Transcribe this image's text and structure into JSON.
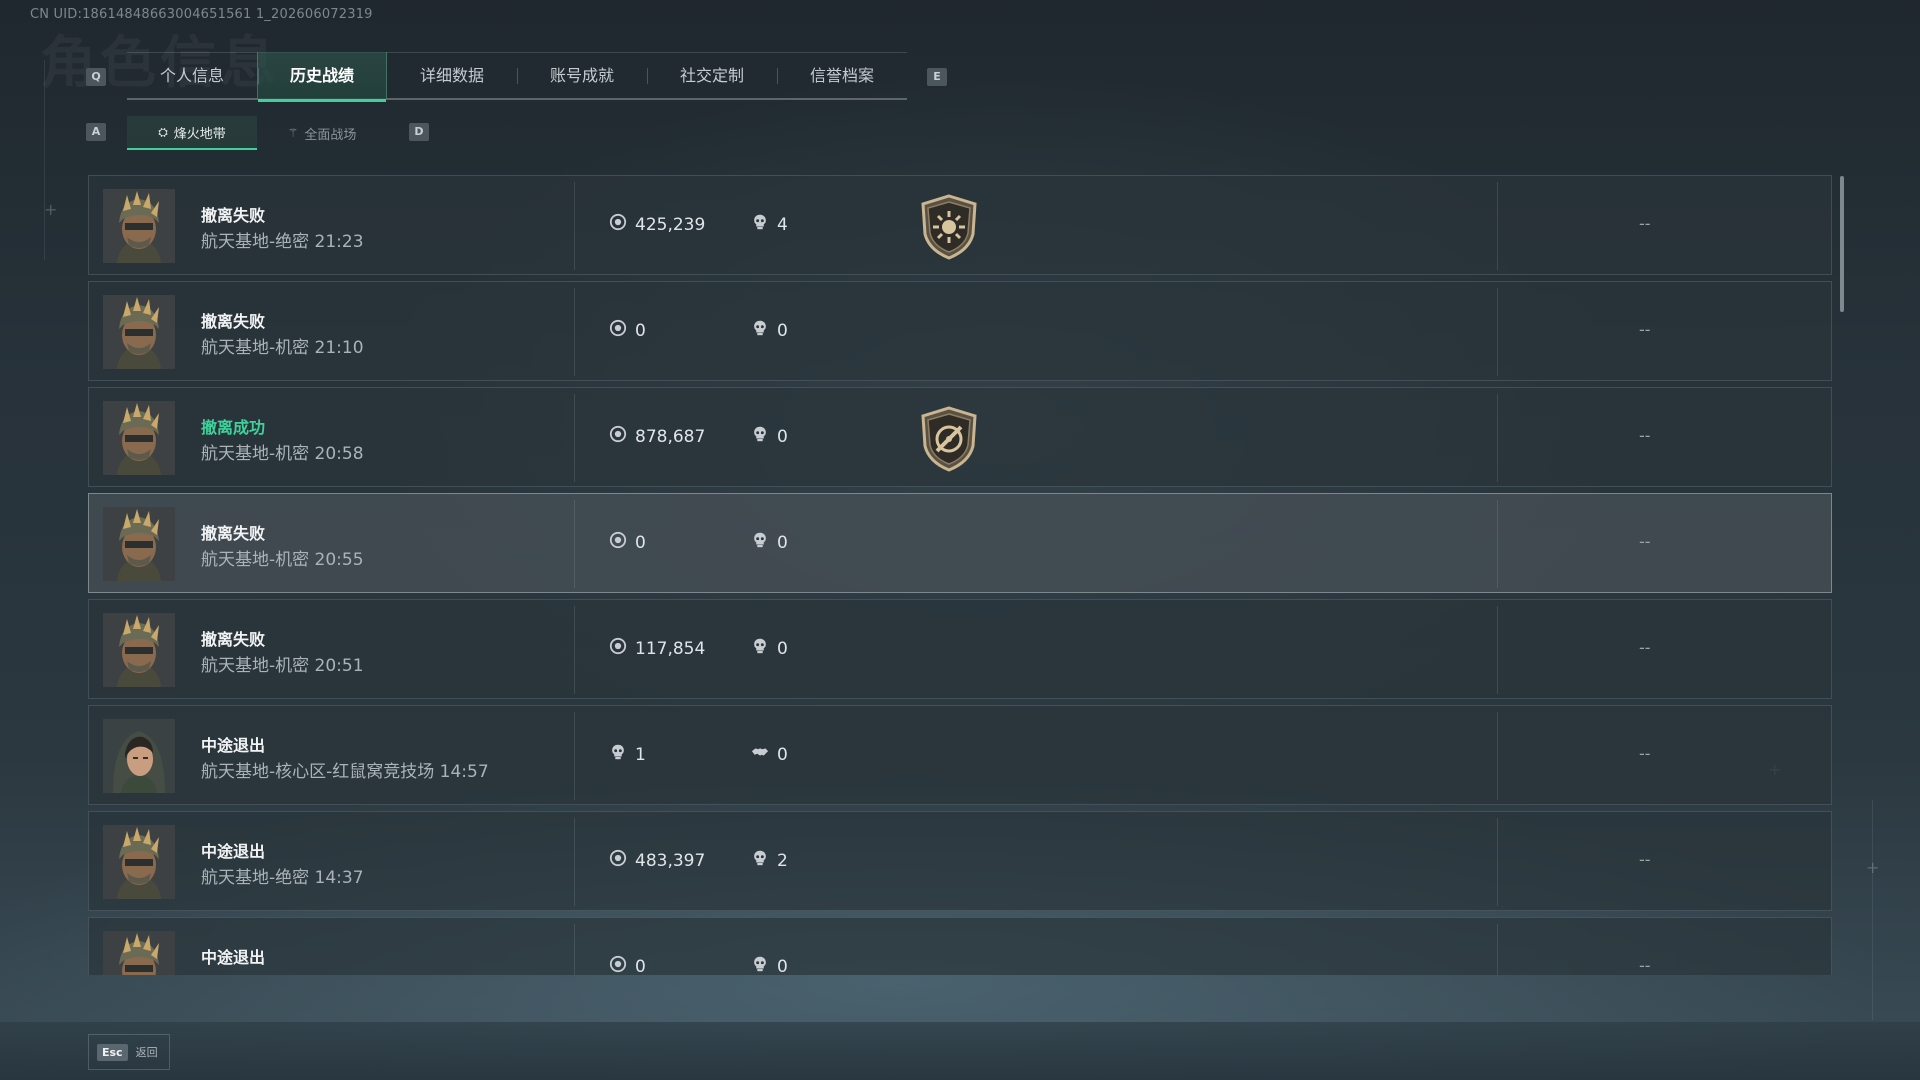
{
  "header": {
    "uid": "CN UID:18614848663004651561 1_202606072319",
    "faded_title": "角色信息"
  },
  "keys": {
    "prev_tab": "Q",
    "next_tab": "E",
    "prev_sub": "A",
    "next_sub": "D"
  },
  "tabs": [
    {
      "label": "个人信息",
      "active": false
    },
    {
      "label": "历史战绩",
      "active": true
    },
    {
      "label": "详细数据",
      "active": false
    },
    {
      "label": "账号成就",
      "active": false
    },
    {
      "label": "社交定制",
      "active": false
    },
    {
      "label": "信誉档案",
      "active": false
    }
  ],
  "subtabs": [
    {
      "label": "烽火地带",
      "active": true
    },
    {
      "label": "全面战场",
      "active": false
    }
  ],
  "records": [
    {
      "result": "撤离失败",
      "detail": "航天基地-绝密 21:23",
      "stat1": "425,239",
      "stat2": "4",
      "stat1_icon": "coin-icon",
      "stat2_icon": "skull-icon",
      "badge": "sun-shield-icon",
      "value": "--",
      "avatar": "helmet-operator",
      "success": false
    },
    {
      "result": "撤离失败",
      "detail": "航天基地-机密 21:10",
      "stat1": "0",
      "stat2": "0",
      "stat1_icon": "coin-icon",
      "stat2_icon": "skull-icon",
      "badge": "",
      "value": "--",
      "avatar": "helmet-operator",
      "success": false
    },
    {
      "result": "撤离成功",
      "detail": "航天基地-机密 20:58",
      "stat1": "878,687",
      "stat2": "0",
      "stat1_icon": "coin-icon",
      "stat2_icon": "skull-icon",
      "badge": "crosshair-shield-icon",
      "value": "--",
      "avatar": "helmet-operator",
      "success": true
    },
    {
      "result": "撤离失败",
      "detail": "航天基地-机密 20:55",
      "stat1": "0",
      "stat2": "0",
      "stat1_icon": "coin-icon",
      "stat2_icon": "skull-icon",
      "badge": "",
      "value": "--",
      "avatar": "helmet-operator",
      "success": false
    },
    {
      "result": "撤离失败",
      "detail": "航天基地-机密 20:51",
      "stat1": "117,854",
      "stat2": "0",
      "stat1_icon": "coin-icon",
      "stat2_icon": "skull-icon",
      "badge": "",
      "value": "--",
      "avatar": "helmet-operator",
      "success": false
    },
    {
      "result": "中途退出",
      "detail": "航天基地-核心区-红鼠窝竞技场 14:57",
      "stat1": "1",
      "stat2": "0",
      "stat1_icon": "skull-icon",
      "stat2_icon": "handshake-icon",
      "badge": "",
      "value": "--",
      "avatar": "hooded-operator",
      "success": false
    },
    {
      "result": "中途退出",
      "detail": "航天基地-绝密 14:37",
      "stat1": "483,397",
      "stat2": "2",
      "stat1_icon": "coin-icon",
      "stat2_icon": "skull-icon",
      "badge": "",
      "value": "--",
      "avatar": "helmet-operator",
      "success": false
    },
    {
      "result": "中途退出",
      "detail": "",
      "stat1": "0",
      "stat2": "0",
      "stat1_icon": "coin-icon",
      "stat2_icon": "skull-icon",
      "badge": "",
      "value": "--",
      "avatar": "helmet-operator",
      "success": false
    }
  ],
  "highlighted_row": 3,
  "footer": {
    "back_key": "Esc",
    "back_label": "返回"
  },
  "colors": {
    "accent": "#3fd19a",
    "success": "#3fd19a",
    "row_bg": "#2a343a"
  }
}
